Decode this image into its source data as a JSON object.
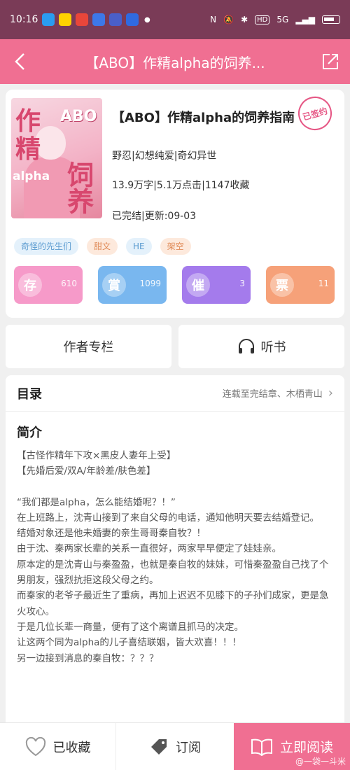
{
  "status_bar": {
    "time": "10:16",
    "network": "5G",
    "hd": "HD"
  },
  "nav": {
    "title": "【ABO】作精alpha的饲养..."
  },
  "book": {
    "title": "【ABO】作精alpha的饲养指南",
    "signed_badge": "已签约",
    "author_genre": "野忍|幻想纯爱|奇幻异世",
    "stats": "13.9万字|5.1万点击|1147收藏",
    "status": "已完结|更新:09-03",
    "cover": {
      "big1": "作",
      "big2": "精",
      "abo": "ABO",
      "alpha": "alpha",
      "side": "饲养"
    }
  },
  "tags": [
    "奇怪的先生们",
    "甜文",
    "HE",
    "架空"
  ],
  "actions": [
    {
      "icon": "存",
      "count": "610"
    },
    {
      "icon": "賞",
      "count": "1099"
    },
    {
      "icon": "催",
      "count": "3"
    },
    {
      "icon": "票",
      "count": "11"
    }
  ],
  "author_column": "作者专栏",
  "listen": "听书",
  "catalog": {
    "heading": "目录",
    "status": "连载至完结章、木栖青山"
  },
  "intro": {
    "heading": "简介",
    "lines": [
      "【古怪作精年下攻×黑皮人妻年上受】",
      "【先婚后爱/双A/年龄差/肤色差】",
      "",
      "“我们都是alpha，怎么能结婚呢？！”",
      "在上班路上，沈青山接到了来自父母的电话，通知他明天要去结婚登记。",
      "结婚对象还是他未婚妻的亲生哥哥秦自牧？！",
      "由于沈、秦两家长辈的关系一直很好，两家早早便定了娃娃亲。",
      "原本定的是沈青山与秦盈盈，也就是秦自牧的妹妹，可惜秦盈盈自己找了个男朋友，强烈抗拒这段父母之约。",
      "而秦家的老爷子最近生了重病，再加上迟迟不见膝下的子孙们成家，更是急火攻心。",
      "于是几位长辈一商量，便有了这个离谱且抓马的决定。",
      "让这两个同为alpha的儿子喜结联姻，皆大欢喜！！！",
      "另一边接到消息的秦自牧：？？？"
    ]
  },
  "bottom": {
    "favorited": "已收藏",
    "subscribe": "订阅",
    "read": "立即阅读",
    "watermark": "@一袋一斗米"
  },
  "colors": {
    "accent": "#f06f92",
    "status_bar": "#7a3b57"
  }
}
